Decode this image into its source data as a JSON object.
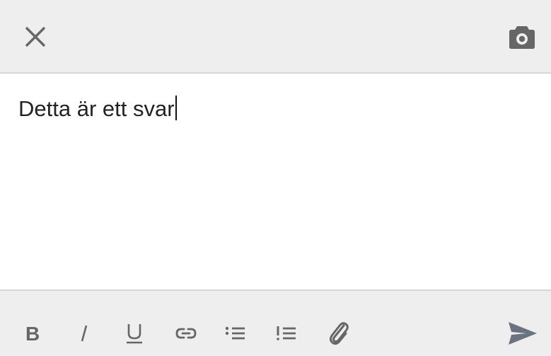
{
  "header": {
    "close_icon": "close-icon",
    "camera_icon": "camera-icon"
  },
  "editor": {
    "text": "Detta är ett svar"
  },
  "toolbar": {
    "tools": [
      {
        "name": "bold",
        "icon": "bold-icon"
      },
      {
        "name": "italic",
        "icon": "italic-icon"
      },
      {
        "name": "underline",
        "icon": "underline-icon"
      },
      {
        "name": "link",
        "icon": "link-icon"
      },
      {
        "name": "bulleted-list",
        "icon": "bulleted-list-icon"
      },
      {
        "name": "numbered-list",
        "icon": "numbered-list-icon"
      },
      {
        "name": "attach",
        "icon": "paperclip-icon"
      }
    ],
    "send_icon": "send-icon"
  },
  "colors": {
    "bar_background": "#eeeeee",
    "icon_gray": "#666666",
    "send_color": "#6b7280",
    "text": "#222222"
  }
}
